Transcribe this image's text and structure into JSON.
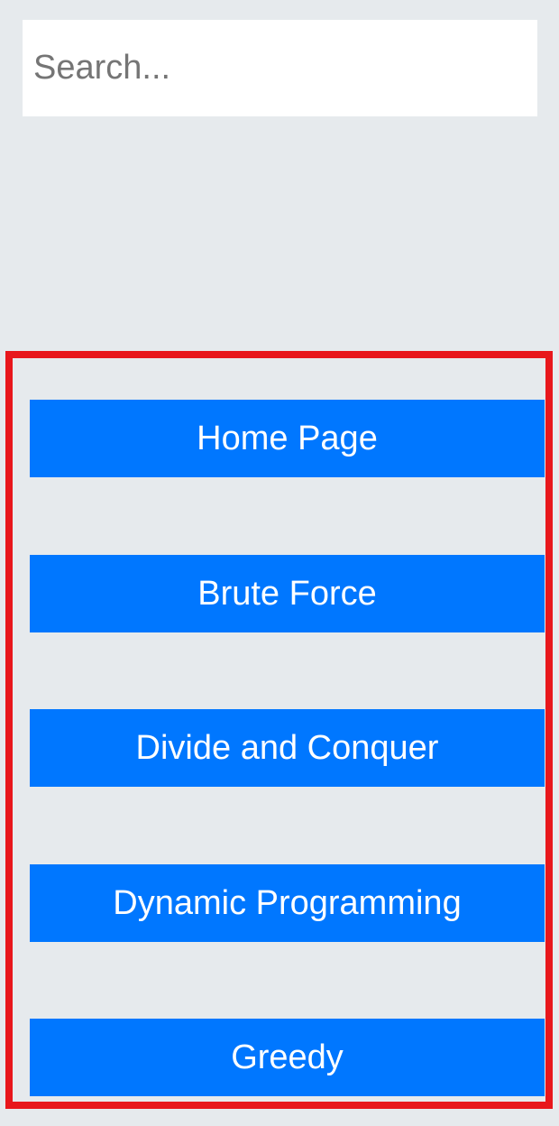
{
  "search": {
    "placeholder": "Search...",
    "value": ""
  },
  "nav": {
    "items": [
      {
        "label": "Home Page"
      },
      {
        "label": "Brute Force"
      },
      {
        "label": "Divide and Conquer"
      },
      {
        "label": "Dynamic Programming"
      },
      {
        "label": "Greedy"
      }
    ]
  },
  "colors": {
    "background": "#e6eaed",
    "button": "#0077ff",
    "button_text": "#ffffff",
    "highlight_border": "#e8171c",
    "search_background": "#ffffff"
  }
}
